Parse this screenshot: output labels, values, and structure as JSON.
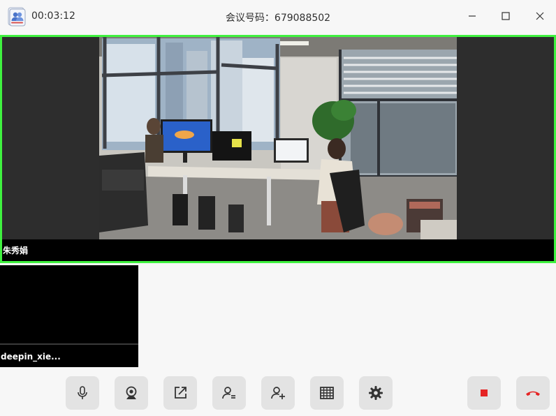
{
  "titlebar": {
    "timer": "00:03:12",
    "meeting_id": "会议号码：679088502",
    "app_icon": "contacts-app-icon",
    "minimize_icon": "minimize-icon",
    "maximize_icon": "maximize-icon",
    "close_icon": "close-icon"
  },
  "main_video": {
    "participant_name": "朱秀娟",
    "active_speaker_color": "#3ff13f"
  },
  "thumbnail": {
    "participant_name": "deepin_xie..."
  },
  "toolbar": {
    "buttons": [
      {
        "icon": "microphone-icon"
      },
      {
        "icon": "camera-icon"
      },
      {
        "icon": "share-screen-icon"
      },
      {
        "icon": "participants-icon"
      },
      {
        "icon": "add-participant-icon"
      },
      {
        "icon": "grid-layout-icon"
      },
      {
        "icon": "settings-icon"
      },
      {
        "icon": "stop-recording-icon",
        "color": "#e52424"
      },
      {
        "icon": "hang-up-icon",
        "color": "#e52424"
      }
    ]
  }
}
